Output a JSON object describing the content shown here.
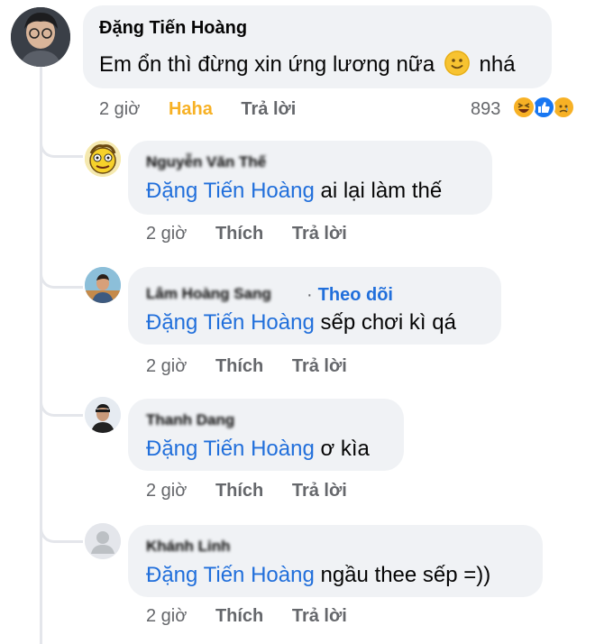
{
  "main_comment": {
    "author": "Đặng Tiến Hoàng",
    "text_before": "Em ổn thì đừng xin ứng lương nữa",
    "emoji": "slightly-smiling-face-icon",
    "text_after": "nhá",
    "time": "2 giờ",
    "reaction_label": "Haha",
    "reply": "Trả lời",
    "reaction_count": "893",
    "reaction_icons": [
      "haha-icon",
      "like-icon",
      "sad-icon"
    ]
  },
  "replies": [
    {
      "author": "Nguyễn Văn Thế",
      "follow": "",
      "mention": "Đặng Tiến Hoàng",
      "text": " ai lại làm thế",
      "time": "2 giờ",
      "like": "Thích",
      "reply": "Trả lời"
    },
    {
      "author": "Lâm Hoàng Sang",
      "follow": "Theo dõi",
      "mention": "Đặng Tiến Hoàng",
      "text": " sếp chơi kì qá",
      "time": "2 giờ",
      "like": "Thích",
      "reply": "Trả lời"
    },
    {
      "author": "Thanh Dang",
      "follow": "",
      "mention": "Đặng Tiến Hoàng",
      "text": " ơ kìa",
      "time": "2 giờ",
      "like": "Thích",
      "reply": "Trả lời"
    },
    {
      "author": "Khánh Linh",
      "follow": "",
      "mention": "Đặng Tiến Hoàng",
      "text": " ngầu thee sếp =))",
      "time": "2 giờ",
      "like": "Thích",
      "reply": "Trả lời"
    }
  ],
  "colors": {
    "link": "#216fdb",
    "bubble": "#f0f2f5",
    "haha": "#f7b125",
    "meta": "#65676b"
  }
}
